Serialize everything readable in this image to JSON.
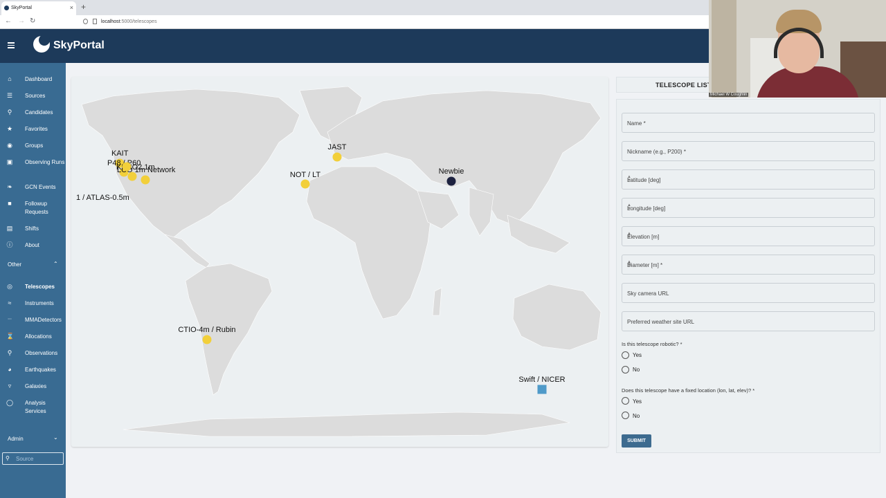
{
  "browser": {
    "tab_title": "SkyPortal",
    "tab_close": "×",
    "new_tab": "+",
    "url_host": "localhost",
    "url_path": ":5000/telescopes"
  },
  "header": {
    "brand": "SkyPortal"
  },
  "sidebar": {
    "items": [
      {
        "label": "Dashboard",
        "icon": "home-icon"
      },
      {
        "label": "Sources",
        "icon": "list-icon"
      },
      {
        "label": "Candidates",
        "icon": "search-icon"
      },
      {
        "label": "Favorites",
        "icon": "star-icon"
      },
      {
        "label": "Groups",
        "icon": "groups-icon"
      },
      {
        "label": "Observing Runs",
        "icon": "observing-icon"
      },
      {
        "label": "GCN Events",
        "icon": "broadcast-icon"
      },
      {
        "label": "Followup Requests",
        "icon": "briefcase-icon"
      },
      {
        "label": "Shifts",
        "icon": "shifts-icon"
      },
      {
        "label": "About",
        "icon": "info-icon"
      }
    ],
    "other_label": "Other",
    "other_items": [
      {
        "label": "Telescopes",
        "icon": "telescope-icon"
      },
      {
        "label": "Instruments",
        "icon": "wifi-icon"
      },
      {
        "label": "MMADetectors",
        "icon": "detector-icon"
      },
      {
        "label": "Allocations",
        "icon": "hourglass-icon"
      },
      {
        "label": "Observations",
        "icon": "search-icon"
      },
      {
        "label": "Earthquakes",
        "icon": "pie-icon"
      },
      {
        "label": "Galaxies",
        "icon": "filter-icon"
      },
      {
        "label": "Analysis Services",
        "icon": "analysis-icon"
      }
    ],
    "admin_label": "Admin",
    "search_placeholder": "Source"
  },
  "map": {
    "markers": [
      {
        "label": "KAIT",
        "color": "#f2cf3a"
      },
      {
        "label": "P48 / P60",
        "color": "#f2cf3a"
      },
      {
        "label": "KPNO2.1m",
        "color": "#f2cf3a"
      },
      {
        "label": "LCO 1m Network",
        "color": "#f2cf3a"
      },
      {
        "label": "1 / ATLAS-0.5m",
        "color": "#f2cf3a"
      },
      {
        "label": "JAST",
        "color": "#f2cf3a"
      },
      {
        "label": "NOT / LT",
        "color": "#f2cf3a"
      },
      {
        "label": "Newbie",
        "color": "#1d2240"
      },
      {
        "label": "CTIO-4m / Rubin",
        "color": "#f2cf3a"
      },
      {
        "label": "Swift / NICER",
        "color": "#4f9ac9"
      }
    ]
  },
  "form": {
    "tab_label": "TELESCOPE LIST",
    "fields": {
      "name": "Name *",
      "nickname": "Nickname (e.g., P200) *",
      "latitude": "Latitude [deg]",
      "longitude": "Longitude [deg]",
      "elevation": "Elevation [m]",
      "diameter": "Diameter [m] *",
      "sky_camera": "Sky camera URL",
      "weather": "Preferred weather site URL"
    },
    "robotic_question": "Is this telescope robotic? *",
    "fixed_question": "Does this telescope have a fixed location (lon, lat, elev)? *",
    "yes": "Yes",
    "no": "No",
    "submit": "SUBMIT"
  },
  "webcam": {
    "name": "Michael W Coughlin"
  }
}
